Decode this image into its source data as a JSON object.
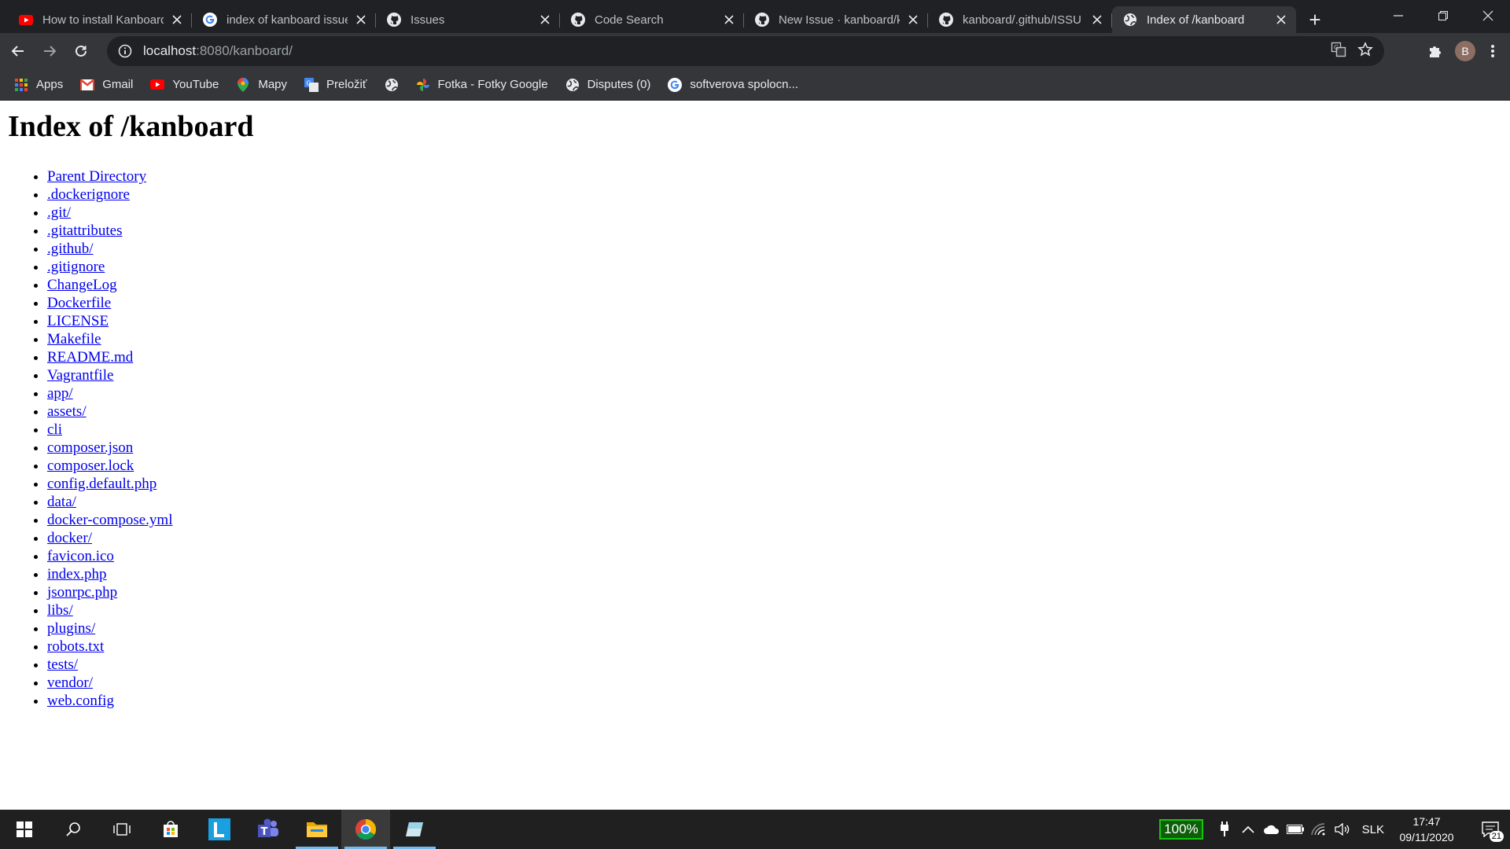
{
  "tabs": [
    {
      "title": "How to install Kanboard",
      "icon": "youtube-icon",
      "active": false
    },
    {
      "title": "index of kanboard issue",
      "icon": "google-icon",
      "active": false
    },
    {
      "title": "Issues",
      "icon": "github-icon",
      "active": false
    },
    {
      "title": "Code Search",
      "icon": "github-icon",
      "active": false
    },
    {
      "title": "New Issue · kanboard/k",
      "icon": "github-icon",
      "active": false
    },
    {
      "title": "kanboard/.github/ISSU",
      "icon": "github-icon",
      "active": false
    },
    {
      "title": "Index of /kanboard",
      "icon": "globe-icon",
      "active": true
    }
  ],
  "address_bar": {
    "host": "localhost",
    "rest": ":8080/kanboard/"
  },
  "avatar_letter": "B",
  "bookmarks": [
    {
      "label": "Apps",
      "icon": "apps-grid-icon"
    },
    {
      "label": "Gmail",
      "icon": "gmail-icon"
    },
    {
      "label": "YouTube",
      "icon": "youtube-icon"
    },
    {
      "label": "Mapy",
      "icon": "maps-pin-icon"
    },
    {
      "label": "Preložiť",
      "icon": "translate-icon"
    },
    {
      "label": "",
      "icon": "globe-icon"
    },
    {
      "label": "Fotka - Fotky Google",
      "icon": "photos-icon"
    },
    {
      "label": "Disputes (0)",
      "icon": "globe-icon"
    },
    {
      "label": "softverova spolocn...",
      "icon": "google-icon"
    }
  ],
  "page": {
    "title": "Index of /kanboard",
    "entries": [
      "Parent Directory",
      ".dockerignore",
      ".git/",
      ".gitattributes",
      ".github/",
      ".gitignore",
      "ChangeLog",
      "Dockerfile",
      "LICENSE",
      "Makefile",
      "README.md",
      "Vagrantfile",
      "app/",
      "assets/",
      "cli",
      "composer.json",
      "composer.lock",
      "config.default.php",
      "data/",
      "docker-compose.yml",
      "docker/",
      "favicon.ico",
      "index.php",
      "jsonrpc.php",
      "libs/",
      "plugins/",
      "robots.txt",
      "tests/",
      "vendor/",
      "web.config"
    ]
  },
  "taskbar": {
    "battery_percent": "100%",
    "language": "SLK",
    "time": "17:47",
    "date": "09/11/2020",
    "notification_count": "21"
  },
  "colors": {
    "tab_strip": "#202124",
    "toolbar": "#35363a",
    "link": "#0000ee",
    "taskbar": "#202020"
  }
}
